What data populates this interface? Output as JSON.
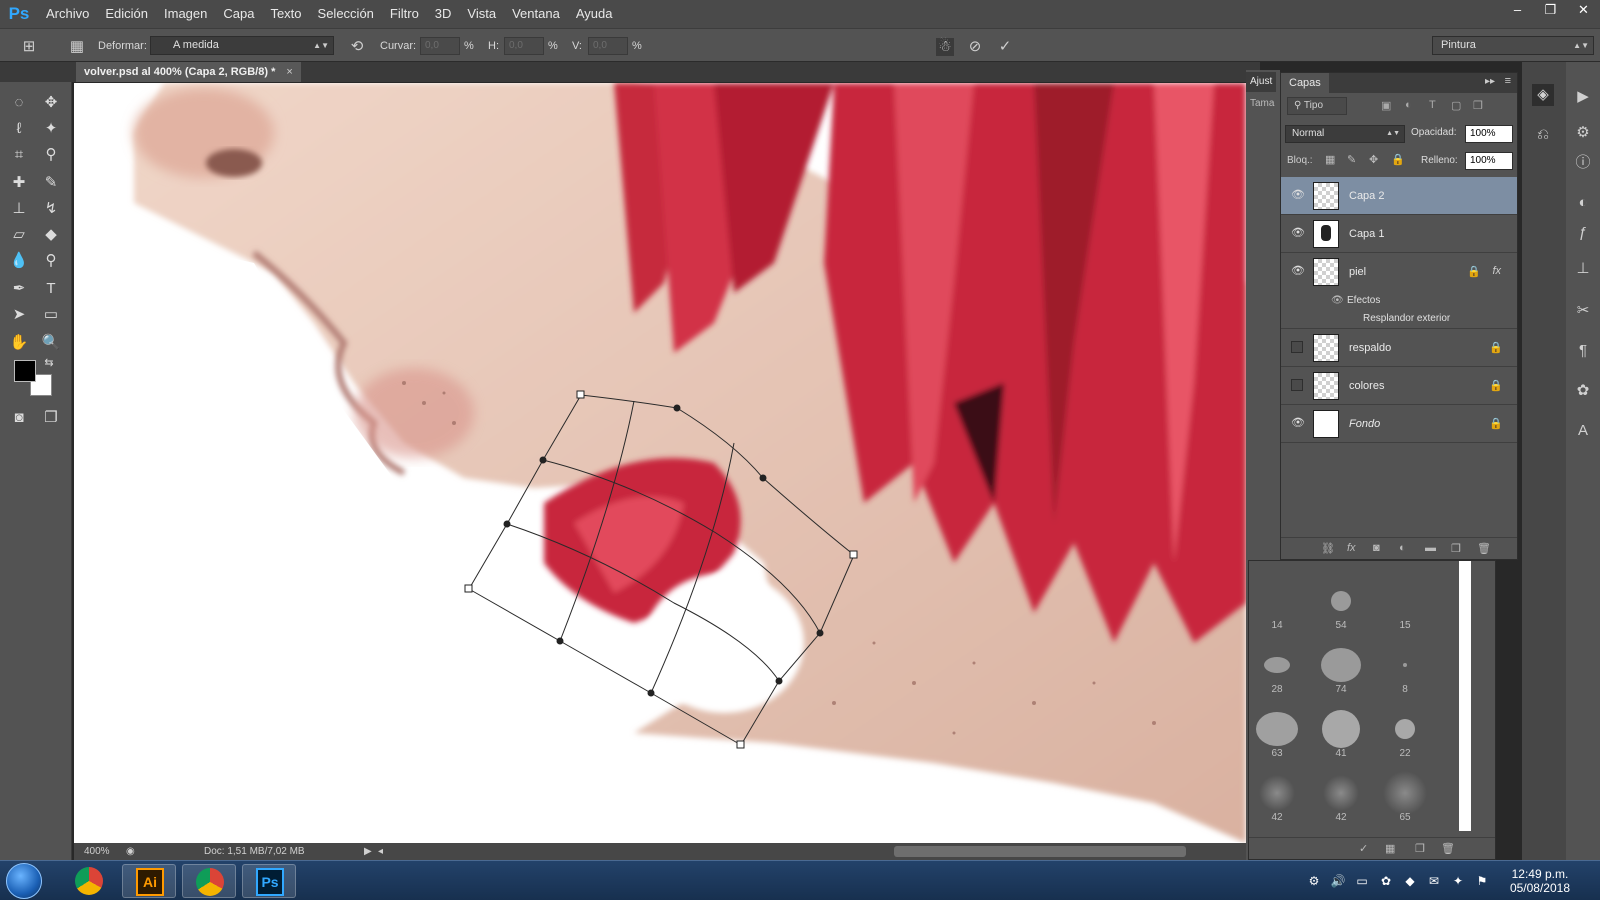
{
  "app": {
    "logo": "Ps",
    "menu": [
      "Archivo",
      "Edición",
      "Imagen",
      "Capa",
      "Texto",
      "Selección",
      "Filtro",
      "3D",
      "Vista",
      "Ventana",
      "Ayuda"
    ],
    "window_controls": [
      "–",
      "❐",
      "✕"
    ]
  },
  "options_bar": {
    "warp_label": "Deformar:",
    "warp_value": "A medida",
    "bend_label": "Curvar:",
    "bend_value": "0,0",
    "bend_unit": "%",
    "h_label": "H:",
    "h_value": "0,0",
    "h_unit": "%",
    "v_label": "V:",
    "v_value": "0,0",
    "v_unit": "%",
    "workspace": "Pintura"
  },
  "document": {
    "tab_title": "volver.psd al 400% (Capa 2, RGB/8) *",
    "tab_close": "×",
    "zoom": "400%",
    "doc_info": "Doc: 1,51 MB/7,02 MB"
  },
  "layers_panel": {
    "tab_adjust": "Ajust",
    "tab_size": "Tama",
    "tab_layers": "Capas",
    "filter_kind": "Tipo",
    "blend_mode": "Normal",
    "opacity_label": "Opacidad:",
    "opacity_value": "100%",
    "lock_label": "Bloq.:",
    "fill_label": "Relleno:",
    "fill_value": "100%",
    "layers": [
      {
        "name": "Capa 2",
        "visible": true
      },
      {
        "name": "Capa 1",
        "visible": true
      },
      {
        "name": "piel",
        "visible": true,
        "fx": "fx",
        "effects_label": "Efectos",
        "effect": "Resplandor exterior"
      },
      {
        "name": "respaldo",
        "visible": false
      },
      {
        "name": "colores",
        "visible": false
      },
      {
        "name": "Fondo",
        "visible": true
      }
    ]
  },
  "brushes": {
    "sizes": [
      "14",
      "54",
      "15",
      "28",
      "74",
      "8",
      "63",
      "41",
      "22",
      "42",
      "42",
      "65"
    ]
  },
  "taskbar": {
    "time": "12:49 p.m.",
    "date": "05/08/2018"
  },
  "colors": {
    "accent": "#31a8ff",
    "selected_layer": "#7d8ea3",
    "hair_red": "#c8283c",
    "skin": "#e8c4b4"
  }
}
